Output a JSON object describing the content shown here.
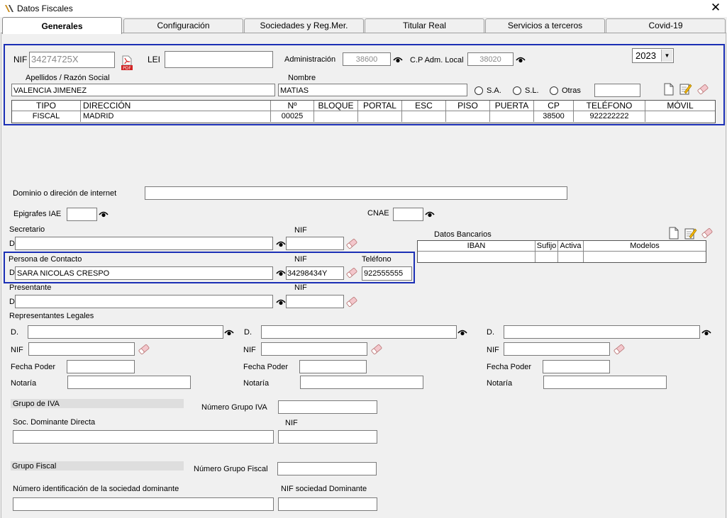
{
  "window": {
    "title": "Datos Fiscales",
    "close": "✕"
  },
  "tabs": [
    {
      "label": "Generales"
    },
    {
      "label": "Configuración"
    },
    {
      "label": "Sociedades y Reg.Mer."
    },
    {
      "label": "Titular Real"
    },
    {
      "label": "Servicios a terceros"
    },
    {
      "label": "Covid-19"
    }
  ],
  "header": {
    "nif_label": "NIF",
    "nif_value": "34274725X",
    "lei_label": "LEI",
    "lei_value": "",
    "admin_label": "Administración",
    "admin_value": "38600",
    "cp_label": "C.P Adm. Local",
    "cp_value": "38020",
    "year": "2023",
    "apellidos_label": "Apellidos / Razón Social",
    "apellidos_value": "VALENCIA JIMENEZ",
    "nombre_label": "Nombre",
    "nombre_value": "MATIAS",
    "radio_sa": "S.A.",
    "radio_sl": "S.L.",
    "radio_otras": "Otras",
    "otras_value": ""
  },
  "address_table": {
    "headers": [
      "TIPO",
      "DIRECCIÓN",
      "Nº",
      "BLOQUE",
      "PORTAL",
      "ESC",
      "PISO",
      "PUERTA",
      "CP",
      "TELÉFONO",
      "MÓVIL"
    ],
    "row": [
      "FISCAL",
      "MADRID",
      "00025",
      "",
      "",
      "",
      "",
      "",
      "38500",
      "922222222",
      ""
    ]
  },
  "dominio": {
    "label": "Dominio o direción de internet",
    "value": ""
  },
  "epigrafes": {
    "label": "Epigrafes IAE",
    "value": ""
  },
  "cnae": {
    "label": "CNAE",
    "value": ""
  },
  "secretario": {
    "label": "Secretario",
    "prefix": "D",
    "value": "",
    "nif_label": "NIF",
    "nif_value": ""
  },
  "contacto": {
    "label": "Persona de Contacto",
    "prefix": "D",
    "value": "SARA NICOLAS CRESPO",
    "nif_label": "NIF",
    "nif_value": "34298434Y",
    "tel_label": "Teléfono",
    "tel_value": "922555555"
  },
  "presentante": {
    "label": "Presentante",
    "prefix": "D",
    "value": "",
    "nif_label": "NIF",
    "nif_value": ""
  },
  "bancarios": {
    "label": "Datos Bancarios",
    "headers": [
      "IBAN",
      "Sufijo",
      "Activa",
      "Modelos"
    ]
  },
  "representantes": {
    "label": "Representantes Legales",
    "d_label": "D.",
    "nif_label": "NIF",
    "fecha_label": "Fecha Poder",
    "notaria_label": "Notaría"
  },
  "iva": {
    "label": "Grupo de IVA",
    "numero_label": "Número Grupo IVA",
    "numero_value": "",
    "soc_label": "Soc. Dominante Directa",
    "nif_label": "NIF"
  },
  "fiscal": {
    "label": "Grupo Fiscal",
    "numero_label": "Número Grupo Fiscal",
    "numero_value": "",
    "ident_label": "Número identificación de la sociedad dominante",
    "nif_dom_label": "NIF sociedad Dominante"
  }
}
